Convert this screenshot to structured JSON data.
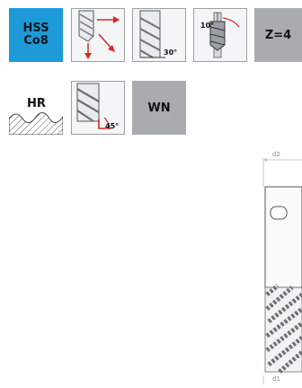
{
  "material_badge": {
    "line1": "HSS",
    "line2": "Co8"
  },
  "flute_angle_30": {
    "label": "30°"
  },
  "corner_angle_10": {
    "label": "10°"
  },
  "teeth_badge": {
    "label": "Z=4"
  },
  "roughing_badge": {
    "label": "HR"
  },
  "helix_45": {
    "label": "45°"
  },
  "shank_badge": {
    "label": "WN"
  },
  "drawing": {
    "top_dimension": "d2",
    "bottom_dimension": "d1"
  },
  "colors": {
    "accent_blue": "#1f9ad8",
    "arrow_red": "#d62828",
    "badge_gray": "#a8abaf"
  },
  "icons": [
    "cutting-direction-icon",
    "helix-30-icon",
    "corner-angle-icon",
    "roughing-profile-icon",
    "helix-45-icon"
  ]
}
